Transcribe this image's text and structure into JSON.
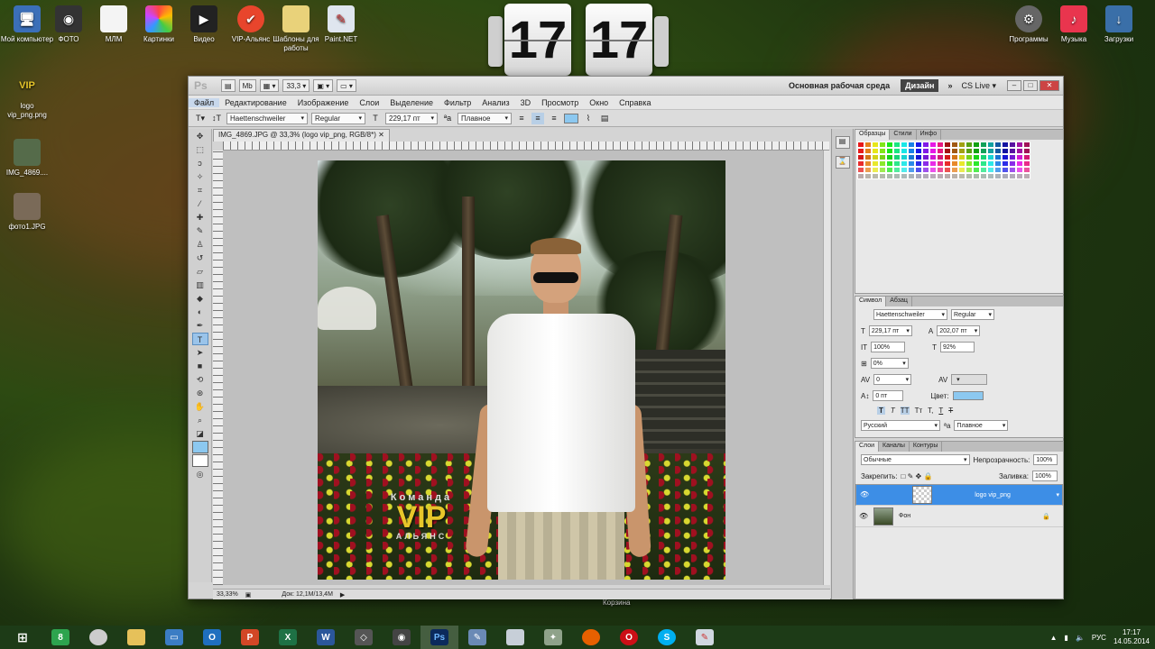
{
  "desktop": {
    "left_icons": [
      {
        "label": "Мой компьютер",
        "icon": "computer-icon"
      },
      {
        "label": "logo vip_png.png",
        "icon": "image-file-icon",
        "badge": "VIP"
      },
      {
        "label": "IMG_4869....",
        "icon": "image-file-icon"
      },
      {
        "label": "фото1.JPG",
        "icon": "image-file-icon"
      }
    ],
    "top_icons": [
      {
        "label": "ФОТО",
        "icon": "camera-icon"
      },
      {
        "label": "МЛМ",
        "icon": "folder-icon"
      },
      {
        "label": "Картинки",
        "icon": "photos-icon"
      },
      {
        "label": "Видео",
        "icon": "video-icon"
      },
      {
        "label": "VIP-Альянс",
        "icon": "browser-icon"
      },
      {
        "label": "Шаблоны для работы",
        "icon": "folder-icon"
      },
      {
        "label": "Paint.NET",
        "icon": "paint-icon"
      }
    ],
    "right_icons": [
      {
        "label": "Программы",
        "icon": "settings-icon"
      },
      {
        "label": "Музыка",
        "icon": "music-icon"
      },
      {
        "label": "Загрузки",
        "icon": "download-icon"
      }
    ],
    "clock": {
      "hours": "17",
      "minutes": "17"
    },
    "recycle_label": "Корзина"
  },
  "photoshop": {
    "logo": "Ps",
    "zoom_select": "33,3",
    "workspace": "Основная рабочая среда",
    "design_button": "Дизайн",
    "cslive": "CS Live",
    "menu": [
      "Файл",
      "Редактирование",
      "Изображение",
      "Слои",
      "Выделение",
      "Фильтр",
      "Анализ",
      "3D",
      "Просмотр",
      "Окно",
      "Справка"
    ],
    "options": {
      "font_family": "Haettenschweiler",
      "font_style": "Regular",
      "font_size": "229,17 пт",
      "antialias": "Плавное"
    },
    "doc_tab": "IMG_4869.JPG @ 33,3% (logo vip_png, RGB/8*)",
    "status": {
      "zoom": "33,33%",
      "doc": "Док: 12,1M/13,4M"
    },
    "image_logo": {
      "line1": "Команда",
      "line2": "VIP",
      "line3": "АЛЬЯНС"
    },
    "swatches_tabs": [
      "Образцы",
      "Стили",
      "Инфо"
    ],
    "char_tabs": [
      "Символ",
      "Абзац"
    ],
    "character": {
      "font": "Haettenschweiler",
      "style": "Regular",
      "size": "229,17 пт",
      "leading": "202,07 пт",
      "vscale": "100%",
      "hscale": "92%",
      "tracking_pct": "0%",
      "kerning": "0",
      "baseline": "0 пт",
      "color_label": "Цвет:",
      "language": "Русский",
      "antialias": "Плавное",
      "styles": [
        "T",
        "T",
        "TT",
        "Tт",
        "T,",
        "T",
        "T"
      ]
    },
    "layers_tabs": [
      "Слои",
      "Каналы",
      "Контуры"
    ],
    "layers": {
      "blend": "Обычные",
      "opacity_label": "Непрозрачность:",
      "opacity": "100%",
      "lock_label": "Закрепить:",
      "fill_label": "Заливка:",
      "fill": "100%",
      "items": [
        {
          "name": "logo vip_png",
          "selected": true
        },
        {
          "name": "Фон",
          "selected": false
        }
      ]
    },
    "colors": {
      "text_color": "#8cc8f0",
      "selection": "#3d8ee6"
    }
  },
  "taskbar": {
    "items": [
      "start",
      "chrome-app",
      "files",
      "remote",
      "outlook",
      "powerpoint",
      "excel",
      "word",
      "navigator",
      "camera",
      "photoshop",
      "editor",
      "calculator",
      "tool",
      "firefox",
      "opera",
      "skype",
      "paint"
    ],
    "tray": {
      "lang": "РУС",
      "time": "17:17",
      "date": "14.05.2014"
    }
  }
}
